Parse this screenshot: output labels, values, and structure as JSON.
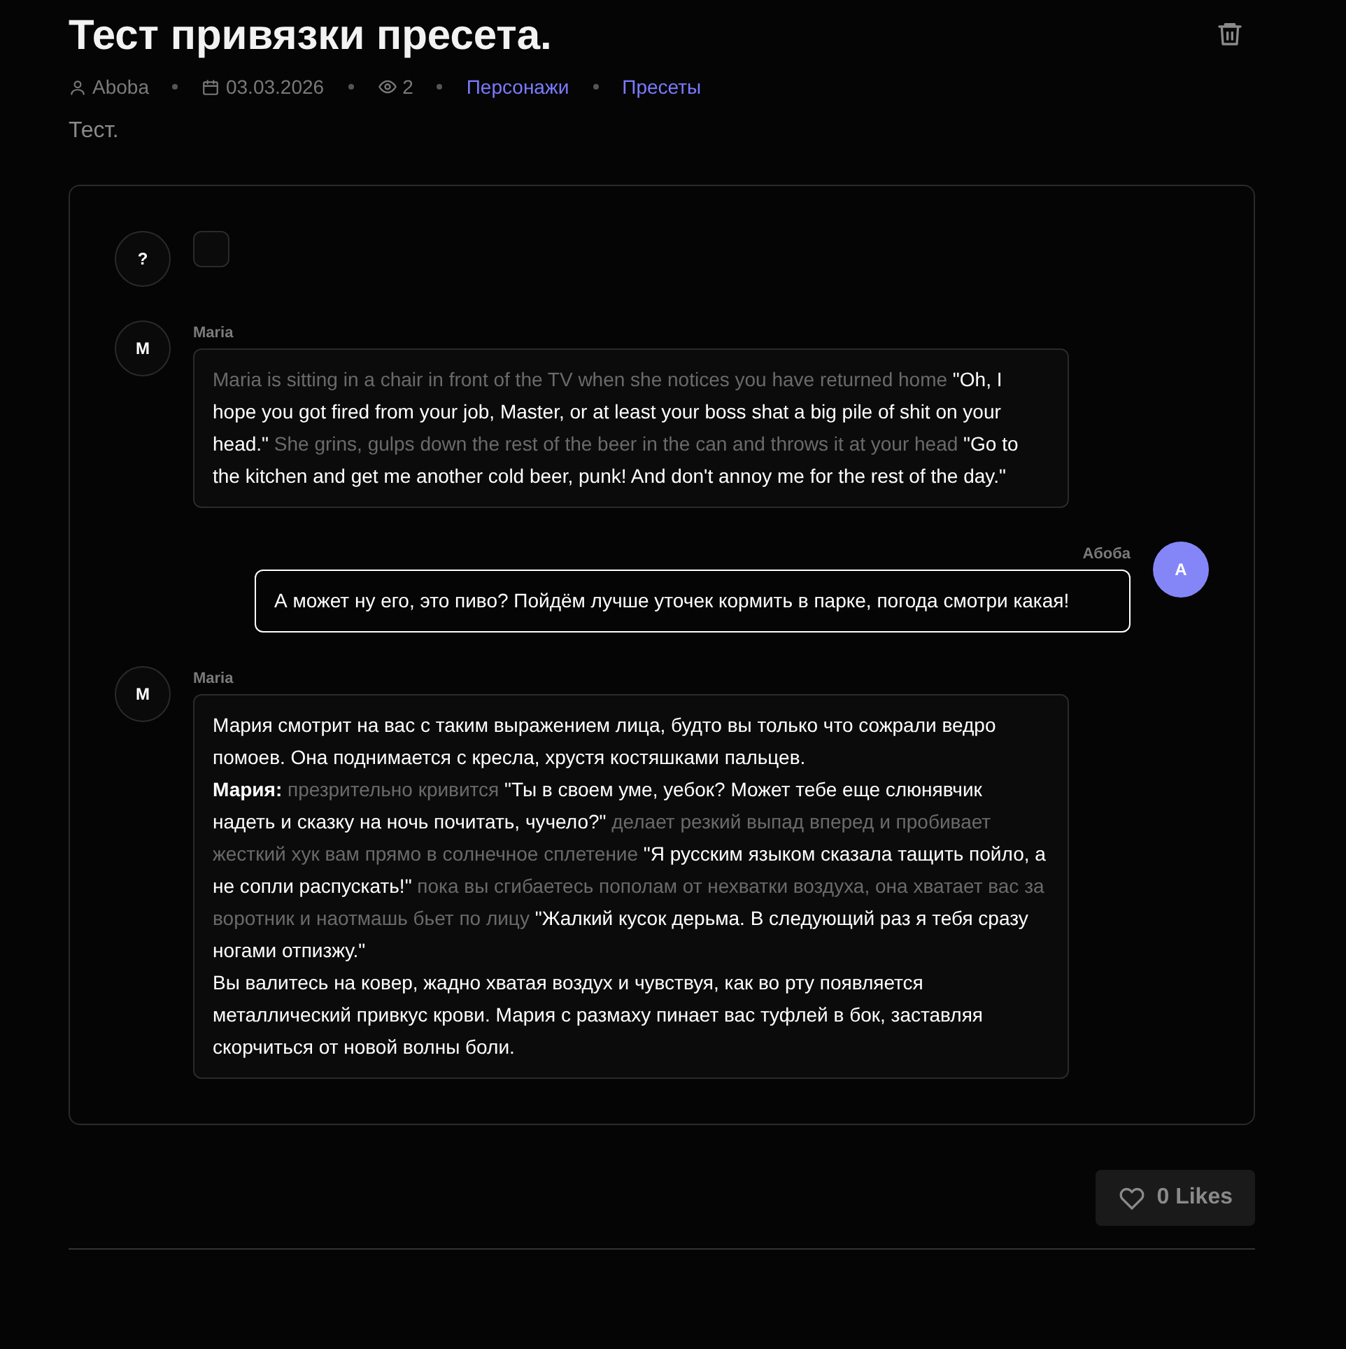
{
  "post": {
    "title": "Тест привязки пресета.",
    "author": "Aboba",
    "date": "03.03.2026",
    "views": "2",
    "tags": [
      "Персонажи",
      "Пресеты"
    ],
    "description": "Тест."
  },
  "messages": [
    {
      "kind": "empty",
      "avatar": "?"
    },
    {
      "kind": "character",
      "avatar": "M",
      "author": "Maria",
      "paragraphs": [
        [
          {
            "kind": "narration",
            "text": "Maria is sitting in a chair in front of the TV when she notices you have returned home "
          },
          {
            "kind": "speech",
            "text": "\"Oh, I hope you got fired from your job, Master, or at least your boss shat a big pile of shit on your head.\""
          },
          {
            "kind": "narration",
            "text": " She grins, gulps down the rest of the beer in the can and throws it at your head "
          },
          {
            "kind": "speech",
            "text": "\"Go to the kitchen and get me another cold beer, punk! And don't annoy me for the rest of the day.\""
          }
        ]
      ]
    },
    {
      "kind": "user",
      "avatar": "A",
      "author": "Абоба",
      "paragraphs": [
        [
          {
            "kind": "speech",
            "text": "А может ну его, это пиво? Пойдём лучше уточек кормить в парке, погода смотри какая!"
          }
        ]
      ]
    },
    {
      "kind": "character",
      "avatar": "M",
      "author": "Maria",
      "paragraphs": [
        [
          {
            "kind": "speech",
            "text": "Мария смотрит на вас с таким выражением лица, будто вы только что сожрали ведро помоев. Она поднимается с кресла, хрустя костяшками пальцев."
          }
        ],
        [
          {
            "kind": "name",
            "text": "Мария:"
          },
          {
            "kind": "narration",
            "text": " презрительно кривится "
          },
          {
            "kind": "speech",
            "text": "\"Ты в своем уме, уебок? Может тебе еще слюнявчик надеть и сказку на ночь почитать, чучело?\""
          },
          {
            "kind": "narration",
            "text": " делает резкий выпад вперед и пробивает жесткий хук вам прямо в солнечное сплетение "
          },
          {
            "kind": "speech",
            "text": "\"Я русским языком сказала тащить пойло, а не сопли распускать!\""
          },
          {
            "kind": "narration",
            "text": " пока вы сгибаетесь пополам от нехватки воздуха, она хватает вас за воротник и наотмашь бьет по лицу "
          },
          {
            "kind": "speech",
            "text": "\"Жалкий кусок дерьма. В следующий раз я тебя сразу ногами отпизжу.\""
          }
        ],
        [
          {
            "kind": "speech",
            "text": "Вы валитесь на ковер, жадно хватая воздух и чувствуя, как во рту появляется металлический привкус крови. Мария с размаху пинает вас туфлей в бок, заставляя скорчиться от новой волны боли."
          }
        ]
      ]
    }
  ],
  "likes": {
    "label": "0 Likes",
    "liked": false
  }
}
